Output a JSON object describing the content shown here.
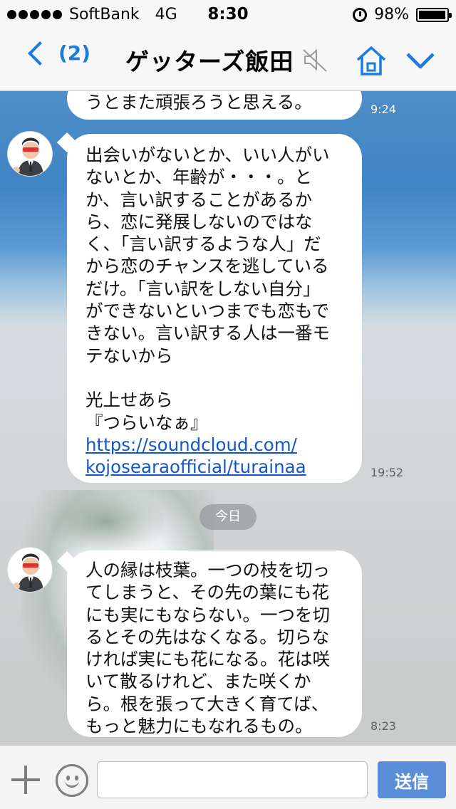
{
  "status_bar": {
    "carrier": "SoftBank",
    "network": "4G",
    "time": "8:30",
    "battery_text": "98%",
    "battery_level": 0.98
  },
  "header": {
    "back_count": "(2)",
    "title": "ゲッターズ飯田",
    "icons": [
      "back-chevron-icon",
      "mute-speaker-icon",
      "home-icon",
      "chevron-down-icon"
    ],
    "accent_color": "#1b7cdc"
  },
  "messages": [
    {
      "lines": [
        "うとまた頑張ろうと思える。"
      ],
      "time": "9:24"
    },
    {
      "lines": [
        "出会いがないとか、いい人がい",
        "ないとか、年齢が・・・。と",
        "か、言い訳することがあるか",
        "ら、恋に発展しないのではな",
        "く、「言い訳するような人」だ",
        "から恋のチャンスを逃している",
        "だけ。「言い訳をしない自分」",
        "ができないといつまでも恋もで",
        "きない。言い訳する人は一番モ",
        "テないから",
        "",
        "光上せあら",
        "『つらいなぁ』"
      ],
      "link_lines": [
        "https://soundcloud.com/",
        "kojosearaofficial/turainaa"
      ],
      "time": "19:52"
    },
    {
      "lines": [
        "人の縁は枝葉。一つの枝を切っ",
        "てしまうと、その先の葉にも花",
        "にも実にもならない。一つを切",
        "るとその先はなくなる。切らな",
        "ければ実にも花になる。花は咲",
        "いて散るけれど、また咲くか",
        "ら。根を張って大きく育てば、",
        "もっと魅力にもなれるもの。"
      ],
      "time": "8:23"
    }
  ],
  "date_separator": "今日",
  "input_bar": {
    "placeholder": "",
    "send_label": "送信",
    "send_color": "#5b8ed9"
  }
}
